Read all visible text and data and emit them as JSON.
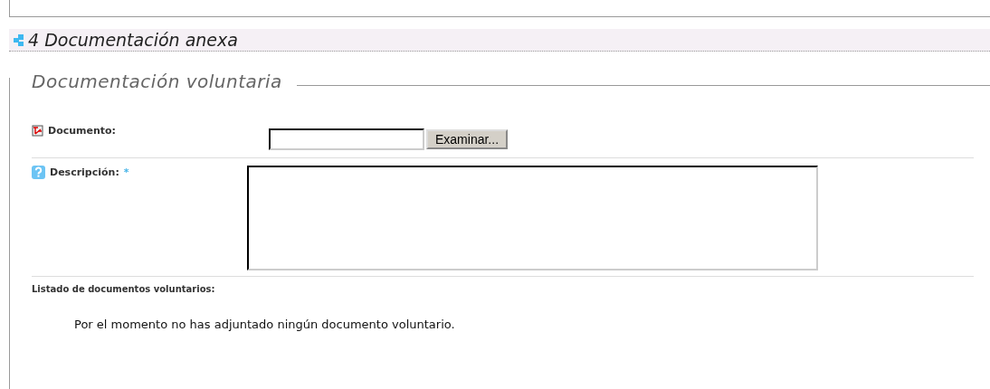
{
  "section": {
    "title": "4 Documentación anexa"
  },
  "fieldset": {
    "legend": "Documentación voluntaria",
    "fields": [
      {
        "kind": "file",
        "label": "Documento:",
        "button": "Examinar..."
      },
      {
        "kind": "textarea",
        "label": "Descripción:",
        "required_mark": "*"
      }
    ],
    "list_label": "Listado de documentos voluntarios:",
    "empty_message": "Por el momento no has adjuntado ningún documento voluntario."
  }
}
